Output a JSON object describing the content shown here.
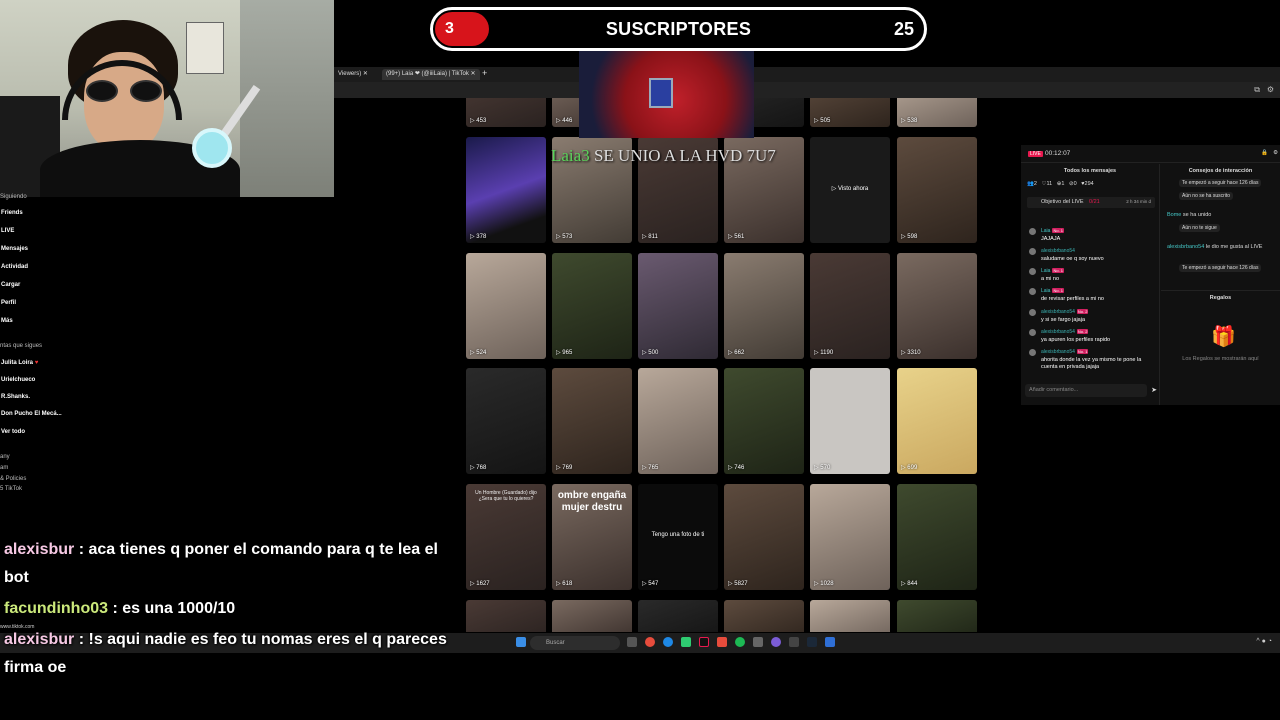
{
  "banner": {
    "left_count": "3",
    "title": "SUSCRIPTORES",
    "right_count": "25"
  },
  "browser": {
    "tabs": [
      "Viewers)",
      "(99+) Laia ❤ (@iiiLaia) | TikTok"
    ],
    "new_tab": "+",
    "close": "✕",
    "url_hint": "www.tiktok.com"
  },
  "sidebar": {
    "items": [
      "Friends",
      "LIVE",
      "Mensajes",
      "Actividad",
      "Cargar",
      "Perfil",
      "Más"
    ],
    "following_header": "ntas que sigues",
    "following": [
      "Julita Loira",
      "Urielchueco",
      "R.Shanks.",
      "Don Pucho El Mecá...",
      "Ver todo"
    ],
    "footer": [
      "any",
      "am",
      "& Policies",
      "5 TikTok"
    ],
    "truncated_top": "Siguiendo"
  },
  "overlay_join": {
    "name": "Laia3",
    "text": " SE UNIO A LA HVD 7U7"
  },
  "grid": {
    "rows": [
      [
        "453",
        "446",
        "",
        "505",
        "505",
        "538"
      ],
      [
        "378",
        "573",
        "811",
        "561",
        "",
        "598"
      ],
      [
        "524",
        "965",
        "500",
        "662",
        "1190",
        "3310"
      ],
      [
        "768",
        "769",
        "765",
        "746",
        "570",
        "699"
      ],
      [
        "1627",
        "618",
        "547",
        "5827",
        "1028",
        "844"
      ]
    ],
    "visto_ahora": "Visto ahora",
    "overlay_texts": [
      "Un Hombre (Guardado) dijo ¿Sera que tu lo quieres?",
      "ombre engaña mujer destru",
      "Tengo una foto de ti"
    ]
  },
  "live": {
    "badge": "LIVE",
    "time": "00:12:07",
    "all_messages": "Todos los mensajes",
    "stats": [
      "2",
      "11",
      "1",
      "0",
      "294"
    ],
    "goal": "Objetivo del LIVE",
    "goal_value": "0/21",
    "goal_time": "2 h 34 min d",
    "messages": [
      {
        "user": "Laia",
        "level": "No. 1",
        "text": "JAJAJA"
      },
      {
        "user": "alexisbrbano54",
        "level": "",
        "text": "saludame oe q soy nuevo"
      },
      {
        "user": "Laia",
        "level": "No. 1",
        "text": "a mi no"
      },
      {
        "user": "Laia",
        "level": "No. 1",
        "text": "de revisar perfiles a mi no"
      },
      {
        "user": "alexisbrbano54",
        "level": "No. 2",
        "text": "y si se fargo jajaja"
      },
      {
        "user": "alexisbrbano54",
        "level": "No. 2",
        "text": "ya apuren los perfiles rapido"
      },
      {
        "user": "alexisbrbano54",
        "level": "No. 1",
        "text": "ahorita donde la vez ya mismo te pone la cuenta en privada jajaja"
      }
    ],
    "comment_placeholder": "Añadir comentario...",
    "tips_header": "Consejos de interacción",
    "tips": [
      "Te empezó a seguir hace 126 días",
      "Aún no se ha suscrito",
      "Aún no te sigue",
      "Te empezó a seguir hace 126 días"
    ],
    "joined_user": "Bome",
    "joined_text": "se ha unido",
    "second_user": "alexisbrbano54",
    "second_text": "le dio me gusta al LIVE",
    "gifts_header": "Regalos",
    "gifts_empty": "Los Regalos se mostrarán aquí"
  },
  "chat": [
    {
      "name": "alexisbur",
      "text": " : aca tienes q poner el comando para q te lea el"
    },
    {
      "name": "",
      "text": "bot"
    },
    {
      "name": "facundinho03",
      "text": " : es una 1000/10"
    },
    {
      "name": "alexisbur",
      "text": " : !s aqui nadie es feo tu nomas eres el q pareces"
    },
    {
      "name": "",
      "text": "firma oe"
    }
  ],
  "taskbar": {
    "search": "Buscar"
  },
  "colors": {
    "accent_red": "#d7141b",
    "live_pink": "#e8194f",
    "chat_pink": "#f7c9e4",
    "chat_green": "#cbe97b"
  }
}
